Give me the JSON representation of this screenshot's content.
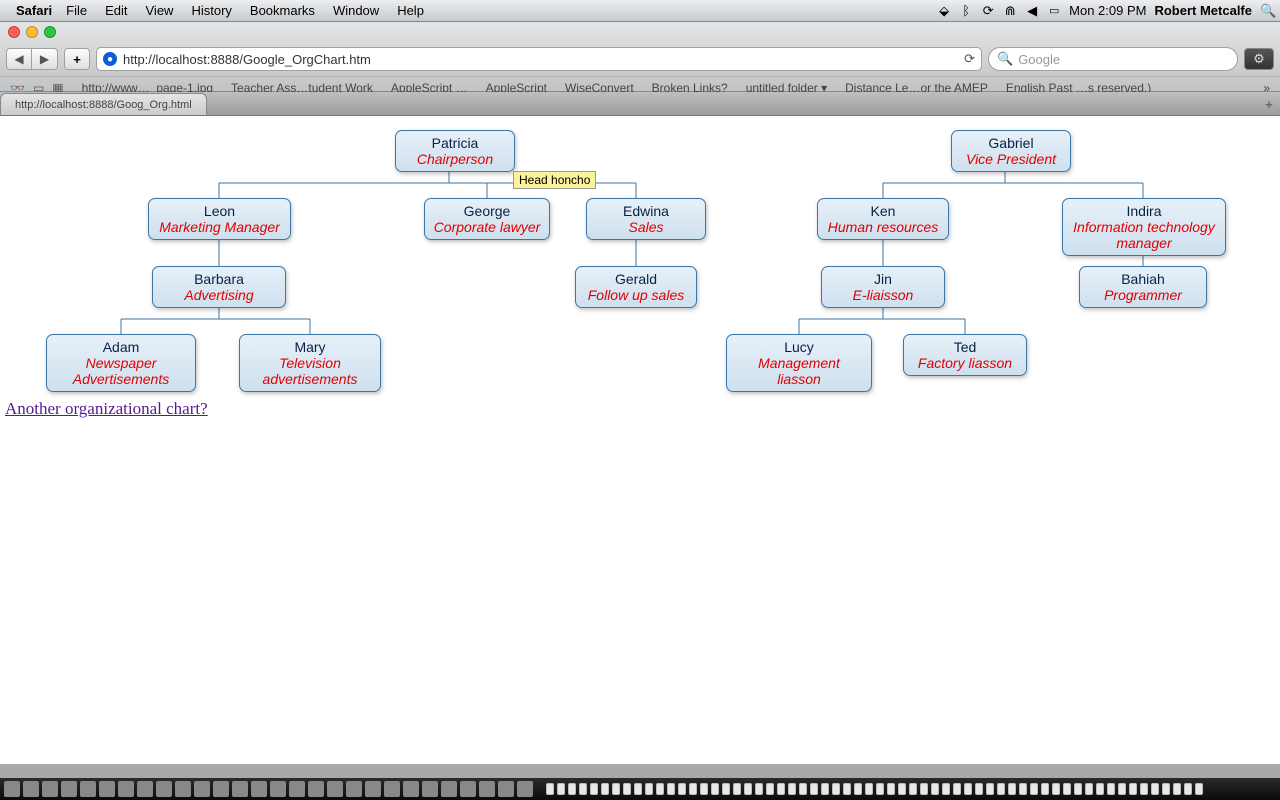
{
  "menubar": {
    "app": "Safari",
    "items": [
      "File",
      "Edit",
      "View",
      "History",
      "Bookmarks",
      "Window",
      "Help"
    ],
    "clock": "Mon 2:09 PM",
    "user": "Robert Metcalfe"
  },
  "toolbar": {
    "url": "http://localhost:8888/Google_OrgChart.htm",
    "search_placeholder": "Google"
  },
  "bookmarks": [
    "http://www…_page-1.jpg",
    "Teacher Ass…tudent Work",
    "AppleScript …",
    "AppleScript",
    "WiseConvert",
    "Broken Links?",
    "untitled folder ▾",
    "Distance Le…or the AMEP",
    "English Past …s reserved.)"
  ],
  "tab": {
    "title": "http://localhost:8888/Goog_Org.html"
  },
  "org": {
    "tooltip": "Head honcho",
    "nodes": {
      "patricia": {
        "name": "Patricia",
        "role": "Chairperson"
      },
      "gabriel": {
        "name": "Gabriel",
        "role": "Vice President"
      },
      "leon": {
        "name": "Leon",
        "role": "Marketing Manager"
      },
      "george": {
        "name": "George",
        "role": "Corporate lawyer"
      },
      "edwina": {
        "name": "Edwina",
        "role": "Sales"
      },
      "ken": {
        "name": "Ken",
        "role": "Human resources"
      },
      "indira": {
        "name": "Indira",
        "role": "Information technology manager"
      },
      "barbara": {
        "name": "Barbara",
        "role": "Advertising"
      },
      "gerald": {
        "name": "Gerald",
        "role": "Follow up sales"
      },
      "jin": {
        "name": "Jin",
        "role": "E-liaisson"
      },
      "bahiah": {
        "name": "Bahiah",
        "role": "Programmer"
      },
      "adam": {
        "name": "Adam",
        "role": "Newspaper Advertisements"
      },
      "mary": {
        "name": "Mary",
        "role": "Television advertisements"
      },
      "lucy": {
        "name": "Lucy",
        "role": "Management liasson"
      },
      "ted": {
        "name": "Ted",
        "role": "Factory liasson"
      }
    },
    "link_text": "Another organizational chart?"
  },
  "chart_data": {
    "type": "tree",
    "title": "",
    "nodes": [
      {
        "id": "patricia",
        "name": "Patricia",
        "role": "Chairperson",
        "manager": null
      },
      {
        "id": "gabriel",
        "name": "Gabriel",
        "role": "Vice President",
        "manager": null
      },
      {
        "id": "leon",
        "name": "Leon",
        "role": "Marketing Manager",
        "manager": "patricia"
      },
      {
        "id": "george",
        "name": "George",
        "role": "Corporate lawyer",
        "manager": "patricia"
      },
      {
        "id": "edwina",
        "name": "Edwina",
        "role": "Sales",
        "manager": "patricia"
      },
      {
        "id": "ken",
        "name": "Ken",
        "role": "Human resources",
        "manager": "gabriel"
      },
      {
        "id": "indira",
        "name": "Indira",
        "role": "Information technology manager",
        "manager": "gabriel"
      },
      {
        "id": "barbara",
        "name": "Barbara",
        "role": "Advertising",
        "manager": "leon"
      },
      {
        "id": "gerald",
        "name": "Gerald",
        "role": "Follow up sales",
        "manager": "edwina"
      },
      {
        "id": "jin",
        "name": "Jin",
        "role": "E-liaisson",
        "manager": "ken"
      },
      {
        "id": "bahiah",
        "name": "Bahiah",
        "role": "Programmer",
        "manager": "indira"
      },
      {
        "id": "adam",
        "name": "Adam",
        "role": "Newspaper Advertisements",
        "manager": "barbara"
      },
      {
        "id": "mary",
        "name": "Mary",
        "role": "Television advertisements",
        "manager": "barbara"
      },
      {
        "id": "lucy",
        "name": "Lucy",
        "role": "Management liasson",
        "manager": "jin"
      },
      {
        "id": "ted",
        "name": "Ted",
        "role": "Factory liasson",
        "manager": "jin"
      }
    ]
  }
}
